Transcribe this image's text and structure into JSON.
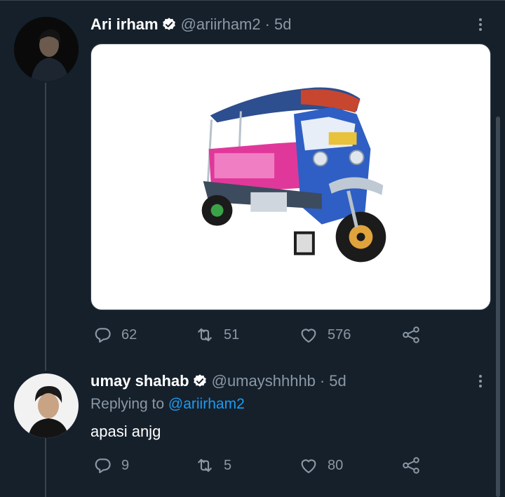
{
  "tweets": [
    {
      "name": "Ari irham",
      "handle": "@ariirham2",
      "separator": "·",
      "time": "5d",
      "has_media": true,
      "media_description_icon": "tuk-tuk-image",
      "actions": {
        "replies": "62",
        "retweets": "51",
        "likes": "576"
      }
    },
    {
      "name": "umay shahab",
      "handle": "@umayshhhhb",
      "separator": "·",
      "time": "5d",
      "replying_prefix": "Replying to",
      "replying_to": "@ariirham2",
      "text": "apasi anjg",
      "actions": {
        "replies": "9",
        "retweets": "5",
        "likes": "80"
      }
    }
  ],
  "icons": {
    "reply": "reply-icon",
    "retweet": "retweet-icon",
    "like": "heart-icon",
    "share": "share-icon",
    "more": "more-icon",
    "verified": "verified-badge-icon"
  },
  "colors": {
    "background": "#15202b",
    "text_secondary": "#8b98a5",
    "link": "#1d9bf0",
    "divider": "#38444d"
  }
}
